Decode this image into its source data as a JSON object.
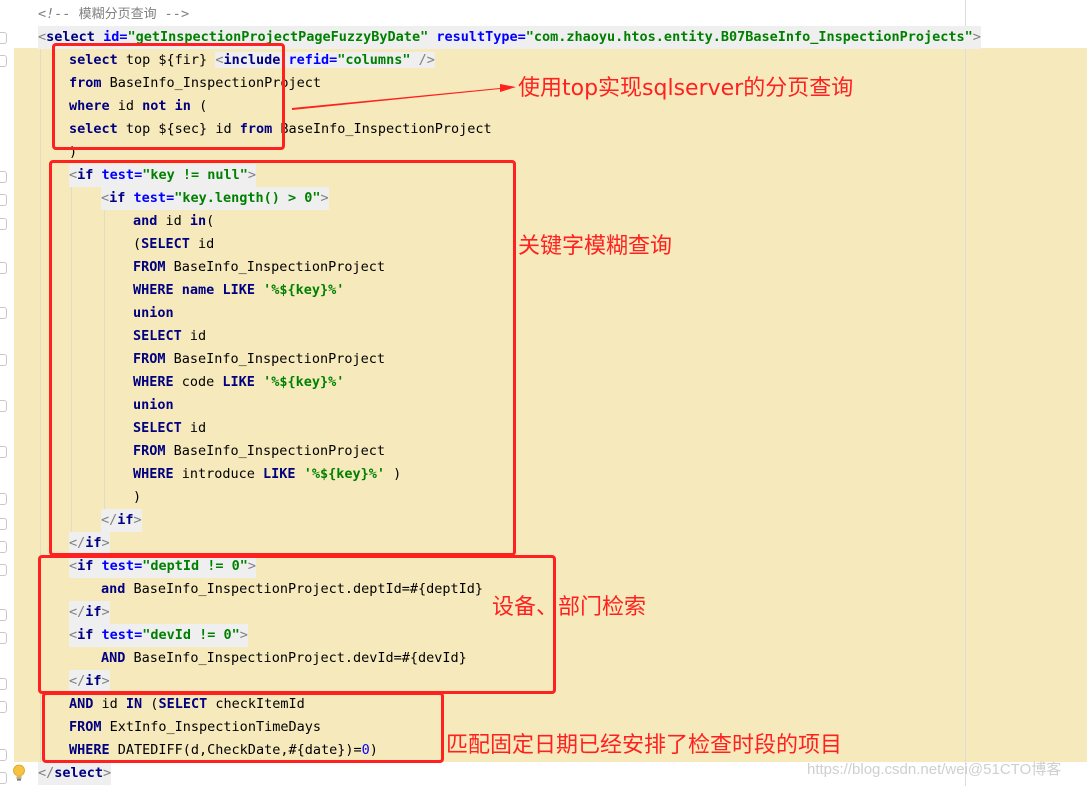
{
  "editor": {
    "lines": [
      {
        "id": "comment",
        "tokens": [
          {
            "c": "cmt",
            "t": "<!-- "
          },
          {
            "c": "cmt-text",
            "t": "模糊分页查询"
          },
          {
            "c": "cmt",
            "t": " -->"
          }
        ]
      },
      {
        "id": "select-open",
        "tokens": [
          {
            "c": "br",
            "t": "<"
          },
          {
            "c": "kw",
            "t": "select"
          },
          {
            "c": "plain",
            "t": " "
          },
          {
            "c": "attr",
            "t": "id"
          },
          {
            "c": "attr",
            "t": "="
          },
          {
            "c": "str",
            "t": "\"getInspectionProjectPageFuzzyByDate\""
          },
          {
            "c": "plain",
            "t": " "
          },
          {
            "c": "attr",
            "t": "resultType"
          },
          {
            "c": "attr",
            "t": "="
          },
          {
            "c": "str",
            "t": "\"com.zhaoyu.htos.entity.B07BaseInfo_InspectionProjects\""
          },
          {
            "c": "br",
            "t": ">"
          }
        ]
      },
      {
        "id": "l3",
        "tokens": [
          {
            "c": "kw",
            "t": "select"
          },
          {
            "c": "plain",
            "t": " top ${fir} "
          },
          {
            "c": "br",
            "t": "<"
          },
          {
            "c": "kw",
            "t": "include"
          },
          {
            "c": "plain",
            "t": " "
          },
          {
            "c": "attr",
            "t": "refid"
          },
          {
            "c": "attr",
            "t": "="
          },
          {
            "c": "str",
            "t": "\"columns\""
          },
          {
            "c": "plain",
            "t": " "
          },
          {
            "c": "br",
            "t": "/>"
          }
        ]
      },
      {
        "id": "l4",
        "tokens": [
          {
            "c": "kw",
            "t": "from"
          },
          {
            "c": "plain",
            "t": " BaseInfo_InspectionProject"
          }
        ]
      },
      {
        "id": "l5",
        "tokens": [
          {
            "c": "kw",
            "t": "where"
          },
          {
            "c": "plain",
            "t": " id "
          },
          {
            "c": "kw",
            "t": "not in"
          },
          {
            "c": "plain",
            "t": " ("
          }
        ]
      },
      {
        "id": "l6",
        "tokens": [
          {
            "c": "kw",
            "t": "select"
          },
          {
            "c": "plain",
            "t": " top ${sec} id "
          },
          {
            "c": "kw",
            "t": "from"
          },
          {
            "c": "plain",
            "t": " BaseInfo_InspectionProject"
          }
        ]
      },
      {
        "id": "l7",
        "tokens": [
          {
            "c": "plain",
            "t": ")"
          }
        ]
      },
      {
        "id": "l8",
        "tokens": [
          {
            "c": "br",
            "t": "<"
          },
          {
            "c": "kw",
            "t": "if"
          },
          {
            "c": "plain",
            "t": " "
          },
          {
            "c": "attr",
            "t": "test"
          },
          {
            "c": "attr",
            "t": "="
          },
          {
            "c": "str",
            "t": "\"key != null\""
          },
          {
            "c": "br",
            "t": ">"
          }
        ]
      },
      {
        "id": "l9",
        "tokens": [
          {
            "c": "br",
            "t": "<"
          },
          {
            "c": "kw",
            "t": "if"
          },
          {
            "c": "plain",
            "t": " "
          },
          {
            "c": "attr",
            "t": "test"
          },
          {
            "c": "attr",
            "t": "="
          },
          {
            "c": "str",
            "t": "\"key.length() > 0\""
          },
          {
            "c": "br",
            "t": ">"
          }
        ]
      },
      {
        "id": "l10",
        "tokens": [
          {
            "c": "kw",
            "t": "and"
          },
          {
            "c": "plain",
            "t": " id "
          },
          {
            "c": "kw",
            "t": "in"
          },
          {
            "c": "plain",
            "t": "("
          }
        ]
      },
      {
        "id": "l11",
        "tokens": [
          {
            "c": "plain",
            "t": "("
          },
          {
            "c": "kw",
            "t": "SELECT"
          },
          {
            "c": "plain",
            "t": " id"
          }
        ]
      },
      {
        "id": "l12",
        "tokens": [
          {
            "c": "kw",
            "t": "FROM"
          },
          {
            "c": "plain",
            "t": " BaseInfo_InspectionProject"
          }
        ]
      },
      {
        "id": "l13",
        "tokens": [
          {
            "c": "kw",
            "t": "WHERE"
          },
          {
            "c": "plain",
            "t": " "
          },
          {
            "c": "kw",
            "t": "name"
          },
          {
            "c": "plain",
            "t": " "
          },
          {
            "c": "kw",
            "t": "LIKE"
          },
          {
            "c": "plain",
            "t": " "
          },
          {
            "c": "str",
            "t": "'%${key}%'"
          }
        ]
      },
      {
        "id": "l14",
        "tokens": [
          {
            "c": "kw",
            "t": "union"
          }
        ]
      },
      {
        "id": "l15",
        "tokens": [
          {
            "c": "kw",
            "t": "SELECT"
          },
          {
            "c": "plain",
            "t": " id"
          }
        ]
      },
      {
        "id": "l16",
        "tokens": [
          {
            "c": "kw",
            "t": "FROM"
          },
          {
            "c": "plain",
            "t": " BaseInfo_InspectionProject"
          }
        ]
      },
      {
        "id": "l17",
        "tokens": [
          {
            "c": "kw",
            "t": "WHERE"
          },
          {
            "c": "plain",
            "t": " code "
          },
          {
            "c": "kw",
            "t": "LIKE"
          },
          {
            "c": "plain",
            "t": " "
          },
          {
            "c": "str",
            "t": "'%${key}%'"
          }
        ]
      },
      {
        "id": "l18",
        "tokens": [
          {
            "c": "kw",
            "t": "union"
          }
        ]
      },
      {
        "id": "l19",
        "tokens": [
          {
            "c": "kw",
            "t": "SELECT"
          },
          {
            "c": "plain",
            "t": " id"
          }
        ]
      },
      {
        "id": "l20",
        "tokens": [
          {
            "c": "kw",
            "t": "FROM"
          },
          {
            "c": "plain",
            "t": " BaseInfo_InspectionProject"
          }
        ]
      },
      {
        "id": "l21",
        "tokens": [
          {
            "c": "kw",
            "t": "WHERE"
          },
          {
            "c": "plain",
            "t": " introduce "
          },
          {
            "c": "kw",
            "t": "LIKE"
          },
          {
            "c": "plain",
            "t": " "
          },
          {
            "c": "str",
            "t": "'%${key}%'"
          },
          {
            "c": "plain",
            "t": " )"
          }
        ]
      },
      {
        "id": "l22",
        "tokens": [
          {
            "c": "plain",
            "t": ")"
          }
        ]
      },
      {
        "id": "l23",
        "tokens": [
          {
            "c": "br",
            "t": "</"
          },
          {
            "c": "kw",
            "t": "if"
          },
          {
            "c": "br",
            "t": ">"
          }
        ]
      },
      {
        "id": "l24",
        "tokens": [
          {
            "c": "br",
            "t": "</"
          },
          {
            "c": "kw",
            "t": "if"
          },
          {
            "c": "br",
            "t": ">"
          }
        ]
      },
      {
        "id": "l25",
        "tokens": [
          {
            "c": "br",
            "t": "<"
          },
          {
            "c": "kw",
            "t": "if"
          },
          {
            "c": "plain",
            "t": " "
          },
          {
            "c": "attr",
            "t": "test"
          },
          {
            "c": "attr",
            "t": "="
          },
          {
            "c": "str",
            "t": "\"deptId != 0\""
          },
          {
            "c": "br",
            "t": ">"
          }
        ]
      },
      {
        "id": "l26",
        "tokens": [
          {
            "c": "kw",
            "t": "and"
          },
          {
            "c": "plain",
            "t": " BaseInfo_InspectionProject.deptId=#{deptId}"
          }
        ]
      },
      {
        "id": "l27",
        "tokens": [
          {
            "c": "br",
            "t": "</"
          },
          {
            "c": "kw",
            "t": "if"
          },
          {
            "c": "br",
            "t": ">"
          }
        ]
      },
      {
        "id": "l28",
        "tokens": [
          {
            "c": "br",
            "t": "<"
          },
          {
            "c": "kw",
            "t": "if"
          },
          {
            "c": "plain",
            "t": " "
          },
          {
            "c": "attr",
            "t": "test"
          },
          {
            "c": "attr",
            "t": "="
          },
          {
            "c": "str",
            "t": "\"devId != 0\""
          },
          {
            "c": "br",
            "t": ">"
          }
        ]
      },
      {
        "id": "l29",
        "tokens": [
          {
            "c": "kw",
            "t": "AND"
          },
          {
            "c": "plain",
            "t": " BaseInfo_InspectionProject.devId=#{devId}"
          }
        ]
      },
      {
        "id": "l30",
        "tokens": [
          {
            "c": "br",
            "t": "</"
          },
          {
            "c": "kw",
            "t": "if"
          },
          {
            "c": "br",
            "t": ">"
          }
        ]
      },
      {
        "id": "l31",
        "tokens": [
          {
            "c": "kw",
            "t": "AND"
          },
          {
            "c": "plain",
            "t": " id "
          },
          {
            "c": "kw",
            "t": "IN"
          },
          {
            "c": "plain",
            "t": " ("
          },
          {
            "c": "kw",
            "t": "SELECT"
          },
          {
            "c": "plain",
            "t": " checkItemId"
          }
        ]
      },
      {
        "id": "l32",
        "tokens": [
          {
            "c": "kw",
            "t": "FROM"
          },
          {
            "c": "plain",
            "t": " ExtInfo_InspectionTimeDays"
          }
        ]
      },
      {
        "id": "l33",
        "tokens": [
          {
            "c": "kw",
            "t": "WHERE"
          },
          {
            "c": "plain",
            "t": " DATEDIFF(d,CheckDate,#{date})="
          },
          {
            "c": "num",
            "t": "0"
          },
          {
            "c": "plain",
            "t": ")"
          }
        ]
      },
      {
        "id": "l34",
        "tokens": [
          {
            "c": "br",
            "t": "</"
          },
          {
            "c": "kw",
            "t": "select"
          },
          {
            "c": "br",
            "t": ">"
          }
        ]
      }
    ]
  },
  "annotations": {
    "top_pagination": "使用top实现sqlserver的分页查询",
    "keyword_fuzzy": "关键字模糊查询",
    "device_dept_search": "设备、部门检索",
    "fixed_date_match": "匹配固定日期已经安排了检查时段的项目"
  },
  "icons": {
    "gutter_hint": "lightbulb-icon"
  },
  "colors": {
    "annotation_red": "#ff2020",
    "highlight_band": "#f6eabc",
    "keyword": "#000080",
    "attribute": "#0000ff",
    "string": "#008000"
  },
  "watermark": "https://blog.csdn.net/wei@51CTO博客"
}
